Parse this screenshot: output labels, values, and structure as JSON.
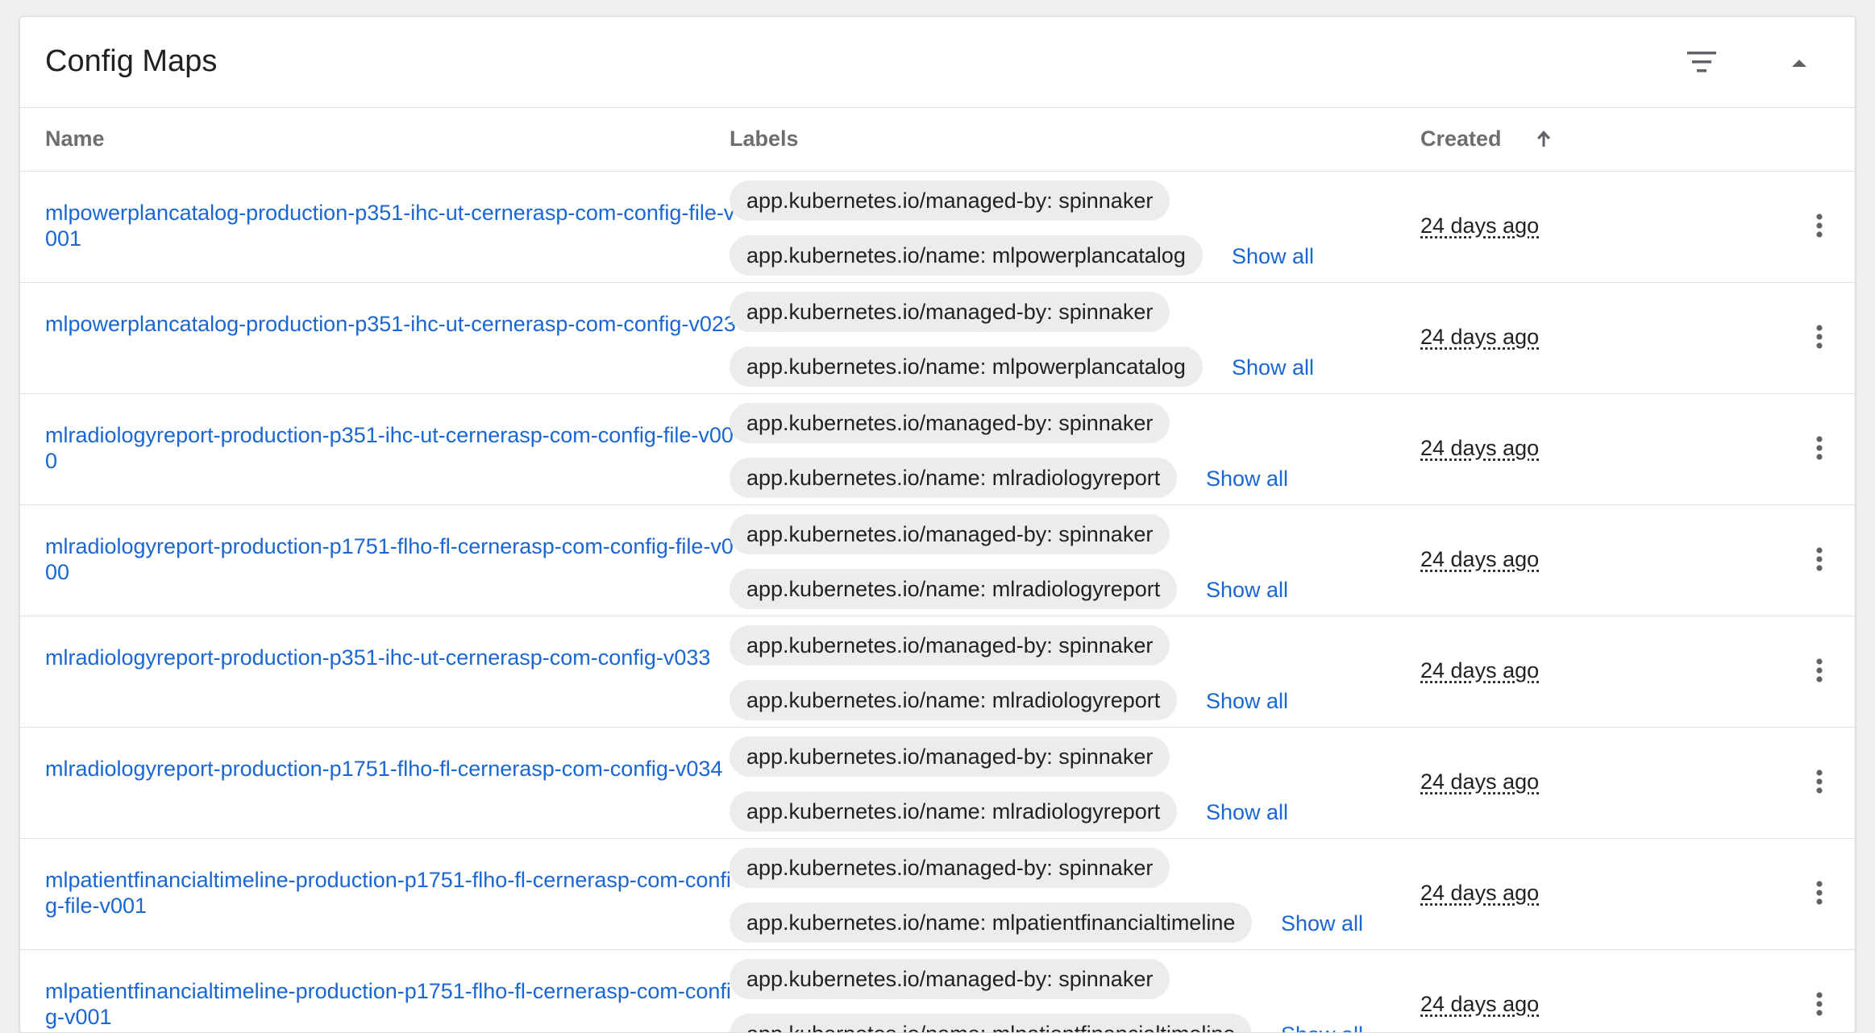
{
  "panel": {
    "title": "Config Maps",
    "filter_icon": "filter-list-icon",
    "collapse_icon": "arrow-drop-up-icon"
  },
  "columns": {
    "name": "Name",
    "labels": "Labels",
    "created": "Created",
    "sort_icon": "arrow-upward-icon"
  },
  "rows": [
    {
      "name": "mlpowerplancatalog-production-p351-ihc-ut-cernerasp-com-config-file-v001",
      "labels": [
        "app.kubernetes.io/managed-by: spinnaker",
        "app.kubernetes.io/name: mlpowerplancatalog"
      ],
      "show_all": "Show all",
      "created": "24 days ago"
    },
    {
      "name": "mlpowerplancatalog-production-p351-ihc-ut-cernerasp-com-config-v023",
      "labels": [
        "app.kubernetes.io/managed-by: spinnaker",
        "app.kubernetes.io/name: mlpowerplancatalog"
      ],
      "show_all": "Show all",
      "created": "24 days ago"
    },
    {
      "name": "mlradiologyreport-production-p351-ihc-ut-cernerasp-com-config-file-v000",
      "labels": [
        "app.kubernetes.io/managed-by: spinnaker",
        "app.kubernetes.io/name: mlradiologyreport"
      ],
      "show_all": "Show all",
      "created": "24 days ago"
    },
    {
      "name": "mlradiologyreport-production-p1751-flho-fl-cernerasp-com-config-file-v000",
      "labels": [
        "app.kubernetes.io/managed-by: spinnaker",
        "app.kubernetes.io/name: mlradiologyreport"
      ],
      "show_all": "Show all",
      "created": "24 days ago"
    },
    {
      "name": "mlradiologyreport-production-p351-ihc-ut-cernerasp-com-config-v033",
      "labels": [
        "app.kubernetes.io/managed-by: spinnaker",
        "app.kubernetes.io/name: mlradiologyreport"
      ],
      "show_all": "Show all",
      "created": "24 days ago"
    },
    {
      "name": "mlradiologyreport-production-p1751-flho-fl-cernerasp-com-config-v034",
      "labels": [
        "app.kubernetes.io/managed-by: spinnaker",
        "app.kubernetes.io/name: mlradiologyreport"
      ],
      "show_all": "Show all",
      "created": "24 days ago"
    },
    {
      "name": "mlpatientfinancialtimeline-production-p1751-flho-fl-cernerasp-com-config-file-v001",
      "labels": [
        "app.kubernetes.io/managed-by: spinnaker",
        "app.kubernetes.io/name: mlpatientfinancialtimeline"
      ],
      "show_all": "Show all",
      "created": "24 days ago"
    },
    {
      "name": "mlpatientfinancialtimeline-production-p1751-flho-fl-cernerasp-com-config-v001",
      "labels": [
        "app.kubernetes.io/managed-by: spinnaker",
        "app.kubernetes.io/name: mlpatientfinancialtimeline"
      ],
      "show_all": "Show all",
      "created": "24 days ago"
    }
  ],
  "row_menu_icon": "more-vert-icon",
  "colors": {
    "link": "#1a66d2",
    "chip_bg": "#ececec",
    "header_text": "#6e6e6e",
    "page_bg": "#edeff1"
  }
}
